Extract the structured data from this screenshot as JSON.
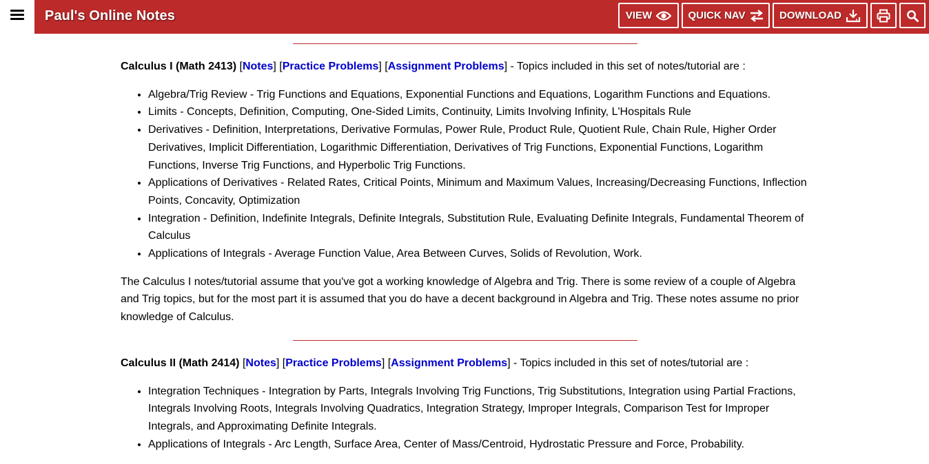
{
  "header": {
    "title": "Paul's Online Notes",
    "buttons": {
      "view": "VIEW",
      "quick_nav": "QUICK NAV",
      "download": "DOWNLOAD"
    },
    "icons": [
      "menu-icon",
      "eye-icon",
      "swap-arrows-icon",
      "download-icon",
      "print-icon",
      "search-icon"
    ],
    "colors": {
      "brand": "#bd2a2a",
      "link": "#0000cc"
    }
  },
  "calc1": {
    "title": "Calculus I (Math 2413)",
    "open1": "[",
    "notes": "Notes",
    "sep1": "] [",
    "practice": "Practice Problems",
    "sep2": "] [",
    "assignment": "Assignment Problems",
    "tail": "] - Topics included in this set of notes/tutorial are :",
    "topics": [
      "Algebra/Trig Review - Trig Functions and Equations, Exponential Functions and Equations, Logarithm Functions and Equations.",
      "Limits - Concepts, Definition, Computing, One-Sided Limits, Continuity, Limits Involving Infinity, L'Hospitals Rule",
      "Derivatives - Definition, Interpretations, Derivative Formulas, Power Rule, Product Rule, Quotient Rule, Chain Rule, Higher Order Derivatives, Implicit Differentiation, Logarithmic Differentiation, Derivatives of Trig Functions, Exponential Functions, Logarithm Functions, Inverse Trig Functions, and Hyperbolic Trig Functions.",
      "Applications of Derivatives - Related Rates, Critical Points, Minimum and Maximum Values, Increasing/Decreasing Functions, Inflection Points, Concavity, Optimization",
      "Integration - Definition, Indefinite Integrals, Definite Integrals, Substitution Rule, Evaluating Definite Integrals, Fundamental Theorem of Calculus",
      "Applications of Integrals - Average Function Value, Area Between Curves, Solids of Revolution, Work."
    ],
    "summary": "The Calculus I notes/tutorial assume that you've got a working knowledge of Algebra and Trig. There is some review of a couple of Algebra and Trig topics, but for the most part it is assumed that you do have a decent background in Algebra and Trig. These notes assume no prior knowledge of Calculus."
  },
  "calc2": {
    "title": "Calculus II (Math 2414)",
    "open1": "[",
    "notes": "Notes",
    "sep1": "] [",
    "practice": "Practice Problems",
    "sep2": "] [",
    "assignment": "Assignment Problems",
    "tail": "] - Topics included in this set of notes/tutorial are :",
    "topics": [
      "Integration Techniques - Integration by Parts, Integrals Involving Trig Functions, Trig Substitutions, Integration using Partial Fractions, Integrals Involving Roots, Integrals Involving Quadratics, Integration Strategy, Improper Integrals, Comparison Test for Improper Integrals, and Approximating Definite Integrals.",
      "Applications of Integrals - Arc Length, Surface Area, Center of Mass/Centroid, Hydrostatic Pressure and Force, Probability."
    ]
  }
}
